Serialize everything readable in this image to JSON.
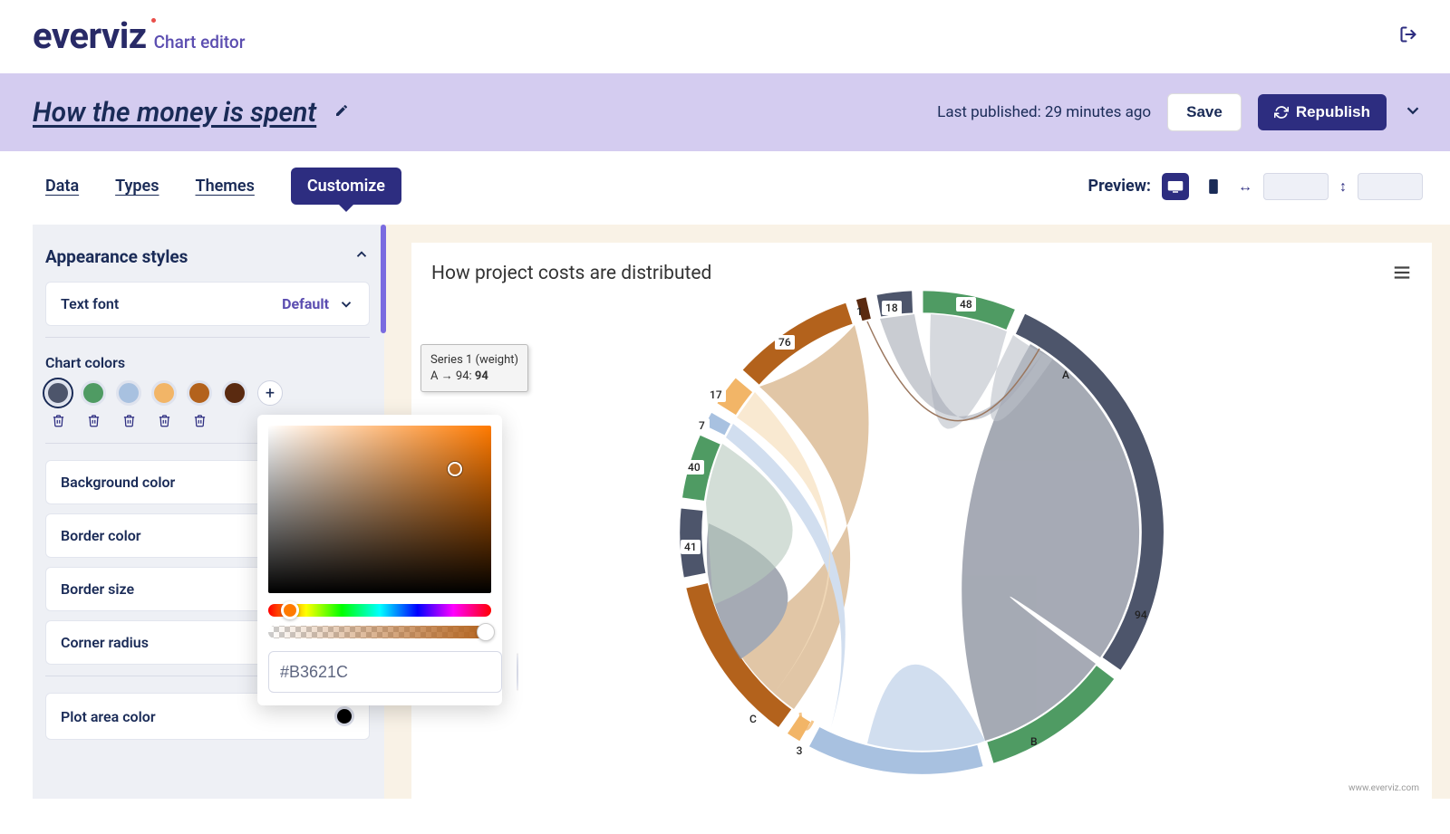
{
  "brand": {
    "name": "everviz",
    "subtitle": "Chart editor"
  },
  "header": {
    "title": "How the money is spent",
    "last_published": "Last published: 29 minutes ago",
    "save_label": "Save",
    "republish_label": "Republish"
  },
  "tabs": {
    "data": "Data",
    "types": "Types",
    "themes": "Themes",
    "customize": "Customize"
  },
  "preview": {
    "label": "Preview:"
  },
  "panel": {
    "section_title": "Appearance styles",
    "text_font_label": "Text font",
    "text_font_value": "Default",
    "chart_colors_label": "Chart colors",
    "background_color_label": "Background color",
    "border_color_label": "Border color",
    "border_size_label": "Border size",
    "corner_radius_label": "Corner radius",
    "plot_area_color_label": "Plot area color",
    "swatches": [
      "#4d556b",
      "#4f9b63",
      "#a8c1e0",
      "#f2b567",
      "#b3621c",
      "#5a2a10"
    ],
    "add_label": "+"
  },
  "picker": {
    "hex": "#B3621C",
    "preview_color": "#b3621c"
  },
  "chart": {
    "title": "How project costs are distributed",
    "credits": "www.everviz.com",
    "tooltip": {
      "series": "Series 1 (weight)",
      "flow": "A → 94: ",
      "value": "94"
    },
    "nodes": {
      "A": "A",
      "B": "B",
      "C": "C",
      "n48": "48",
      "n18": "18",
      "n1": "1",
      "n76": "76",
      "n17": "17",
      "n7": "7",
      "n40": "40",
      "n41": "41",
      "n3": "3",
      "n94": "94"
    }
  },
  "chart_data": {
    "type": "chord",
    "title": "How project costs are distributed",
    "nodes": [
      "A",
      "B",
      "C",
      "48",
      "18",
      "1",
      "76",
      "17",
      "7",
      "40",
      "41",
      "3",
      "94"
    ],
    "links": [
      {
        "from": "A",
        "to": "94",
        "weight": 94
      },
      {
        "from": "A",
        "to": "48",
        "weight": 48
      },
      {
        "from": "A",
        "to": "18",
        "weight": 18
      },
      {
        "from": "A",
        "to": "1",
        "weight": 1
      },
      {
        "from": "B",
        "to": "94",
        "weight": 94
      },
      {
        "from": "B",
        "to": "7",
        "weight": 7
      },
      {
        "from": "B",
        "to": "3",
        "weight": 3
      },
      {
        "from": "C",
        "to": "76",
        "weight": 76
      },
      {
        "from": "C",
        "to": "40",
        "weight": 40
      },
      {
        "from": "C",
        "to": "41",
        "weight": 41
      },
      {
        "from": "C",
        "to": "17",
        "weight": 17
      }
    ],
    "node_colors": {
      "A": "#4d556b",
      "B": "#a8c1e0",
      "C": "#b3621c",
      "48": "#4f9b63",
      "94": "#4f9b63",
      "18": "#4d556b",
      "76": "#b3621c",
      "17": "#f2b567",
      "7": "#a8c1e0",
      "40": "#4f9b63",
      "41": "#4d556b",
      "3": "#f2b567",
      "1": "#5a2a10"
    }
  }
}
